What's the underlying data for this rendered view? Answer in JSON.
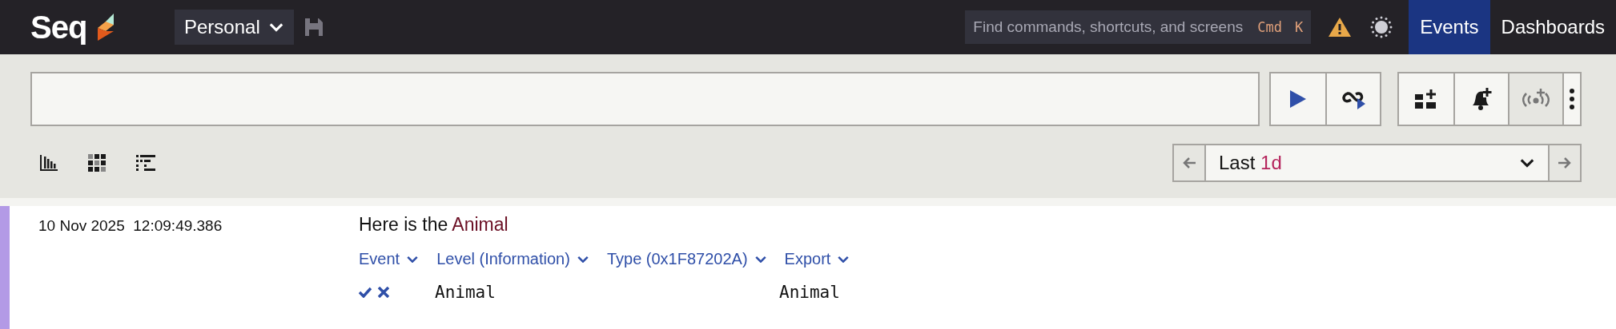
{
  "topbar": {
    "logo": "Seq",
    "workspace": "Personal",
    "search": {
      "placeholder": "Find commands, shortcuts, and screens",
      "shortcut": [
        "Cmd",
        "K"
      ]
    },
    "tabs": [
      {
        "label": "Events",
        "selected": true
      },
      {
        "label": "Dashboards",
        "selected": false
      }
    ]
  },
  "query": {
    "run_buttons": [
      {
        "kind": "run",
        "disabled": false
      },
      {
        "kind": "tail",
        "disabled": false
      }
    ],
    "action_buttons": [
      {
        "kind": "dashboard",
        "disabled": false
      },
      {
        "kind": "alert",
        "disabled": false
      },
      {
        "kind": "signal",
        "disabled": true
      },
      {
        "kind": "more",
        "disabled": false
      }
    ]
  },
  "views": [
    {
      "kind": "chart"
    },
    {
      "kind": "heatmap"
    },
    {
      "kind": "list"
    }
  ],
  "range": {
    "parts": [
      {
        "text": "Last ",
        "kind": "plain"
      },
      {
        "text": "1d",
        "kind": "value"
      }
    ]
  },
  "events": [
    {
      "color": "#b39ae6",
      "timestamp": "10 Nov 2025  12:09:49.386",
      "message": [
        {
          "text": "Here is the ",
          "kind": "plain"
        },
        {
          "text": "Animal",
          "kind": "property"
        }
      ],
      "links": [
        "Event",
        "Level (Information)",
        "Type (0x1F87202A)",
        "Export"
      ],
      "properties": [
        {
          "name": "Animal",
          "value": "Animal"
        }
      ]
    }
  ]
}
